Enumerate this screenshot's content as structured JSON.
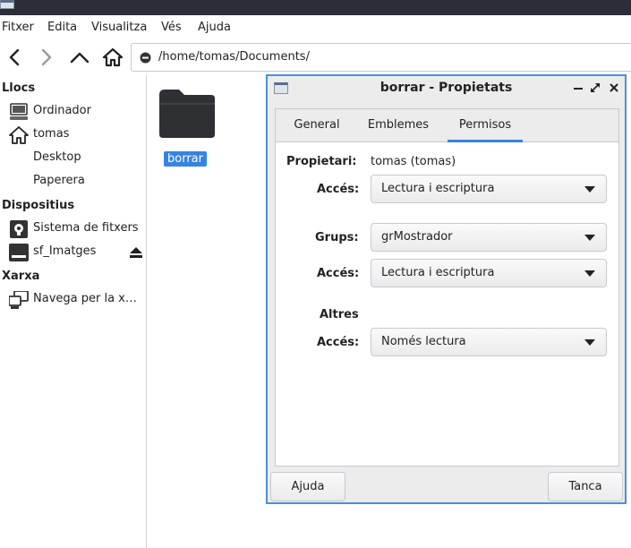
{
  "menubar": {
    "items": [
      "Fitxer",
      "Edita",
      "Visualitza",
      "Vés",
      "Ajuda"
    ]
  },
  "toolbar": {
    "icons": [
      "back-icon",
      "forward-icon",
      "up-icon",
      "home-icon"
    ],
    "path": "/home/tomas/Documents/"
  },
  "sidebar": {
    "sections": [
      {
        "title": "Llocs",
        "items": [
          {
            "label": "Ordinador",
            "icon": "computer-icon"
          },
          {
            "label": "tomas",
            "icon": "home-icon"
          },
          {
            "label": "Desktop",
            "icon": ""
          },
          {
            "label": "Paperera",
            "icon": ""
          }
        ]
      },
      {
        "title": "Dispositius",
        "items": [
          {
            "label": "Sistema de fitxers",
            "icon": "drive-icon"
          },
          {
            "label": "sf_Imatges",
            "icon": "disk-icon"
          }
        ]
      },
      {
        "title": "Xarxa",
        "items": [
          {
            "label": "Navega per la x…",
            "icon": "network-icon"
          }
        ]
      }
    ]
  },
  "files": [
    {
      "name": "borrar",
      "icon": "folder-icon",
      "selected": true
    }
  ],
  "dialog": {
    "title": "borrar - Propietats",
    "controls": [
      "minimize",
      "maximize",
      "close"
    ],
    "tabs": [
      {
        "label": "General",
        "active": false
      },
      {
        "label": "Emblemes",
        "active": false
      },
      {
        "label": "Permisos",
        "active": true
      }
    ],
    "owner_label": "Propietari:",
    "owner_value": "tomas (tomas)",
    "owner_access_label": "Accés:",
    "owner_access_value": "Lectura i escriptura",
    "group_label": "Grups:",
    "group_value": "grMostrador",
    "group_access_label": "Accés:",
    "group_access_value": "Lectura i escriptura",
    "others_label": "Altres",
    "others_access_label": "Accés:",
    "others_access_value": "Només lectura",
    "help_button": "Ajuda",
    "close_button": "Tanca"
  },
  "colors": {
    "accent": "#3584e4",
    "dialog_border": "#4a90d9",
    "topbar": "#2b2e37"
  }
}
